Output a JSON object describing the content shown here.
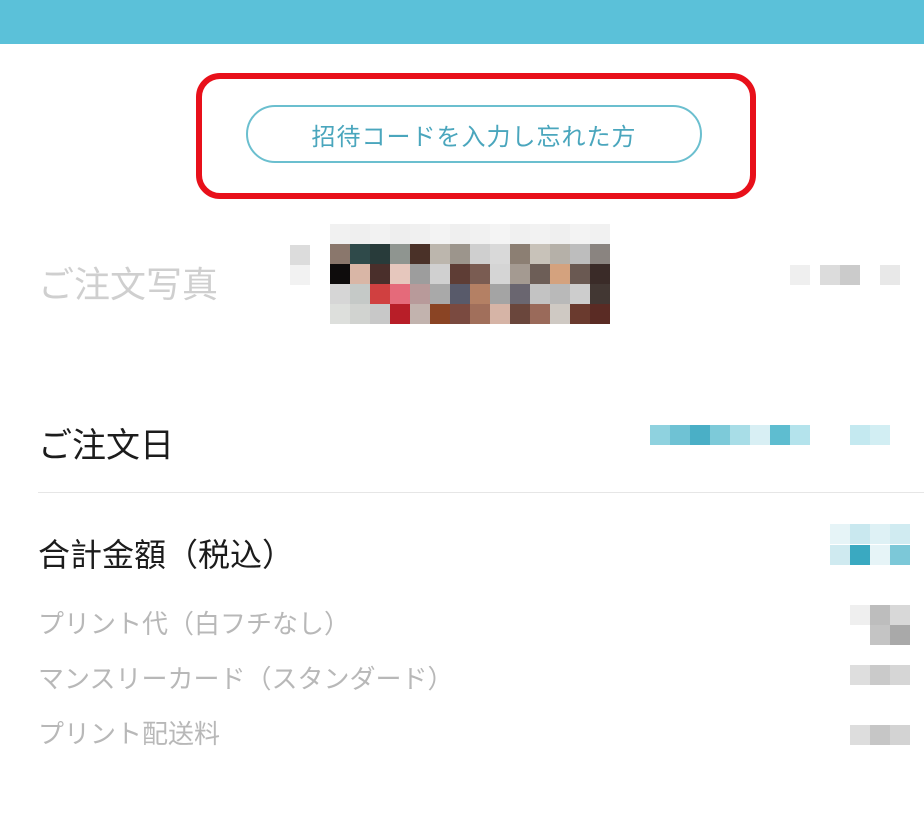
{
  "invite_button": {
    "label": "招待コードを入力し忘れた方"
  },
  "order": {
    "photo_label": "ご注文写真",
    "date_label": "ご注文日",
    "total_label": "合計金額（税込）",
    "breakdown": [
      "プリント代（白フチなし）",
      "マンスリーカード（スタンダード）",
      "プリント配送料"
    ]
  },
  "colors": {
    "header": "#5bc1d9",
    "accent": "#4aa6bd",
    "highlight": "#e8101a"
  }
}
